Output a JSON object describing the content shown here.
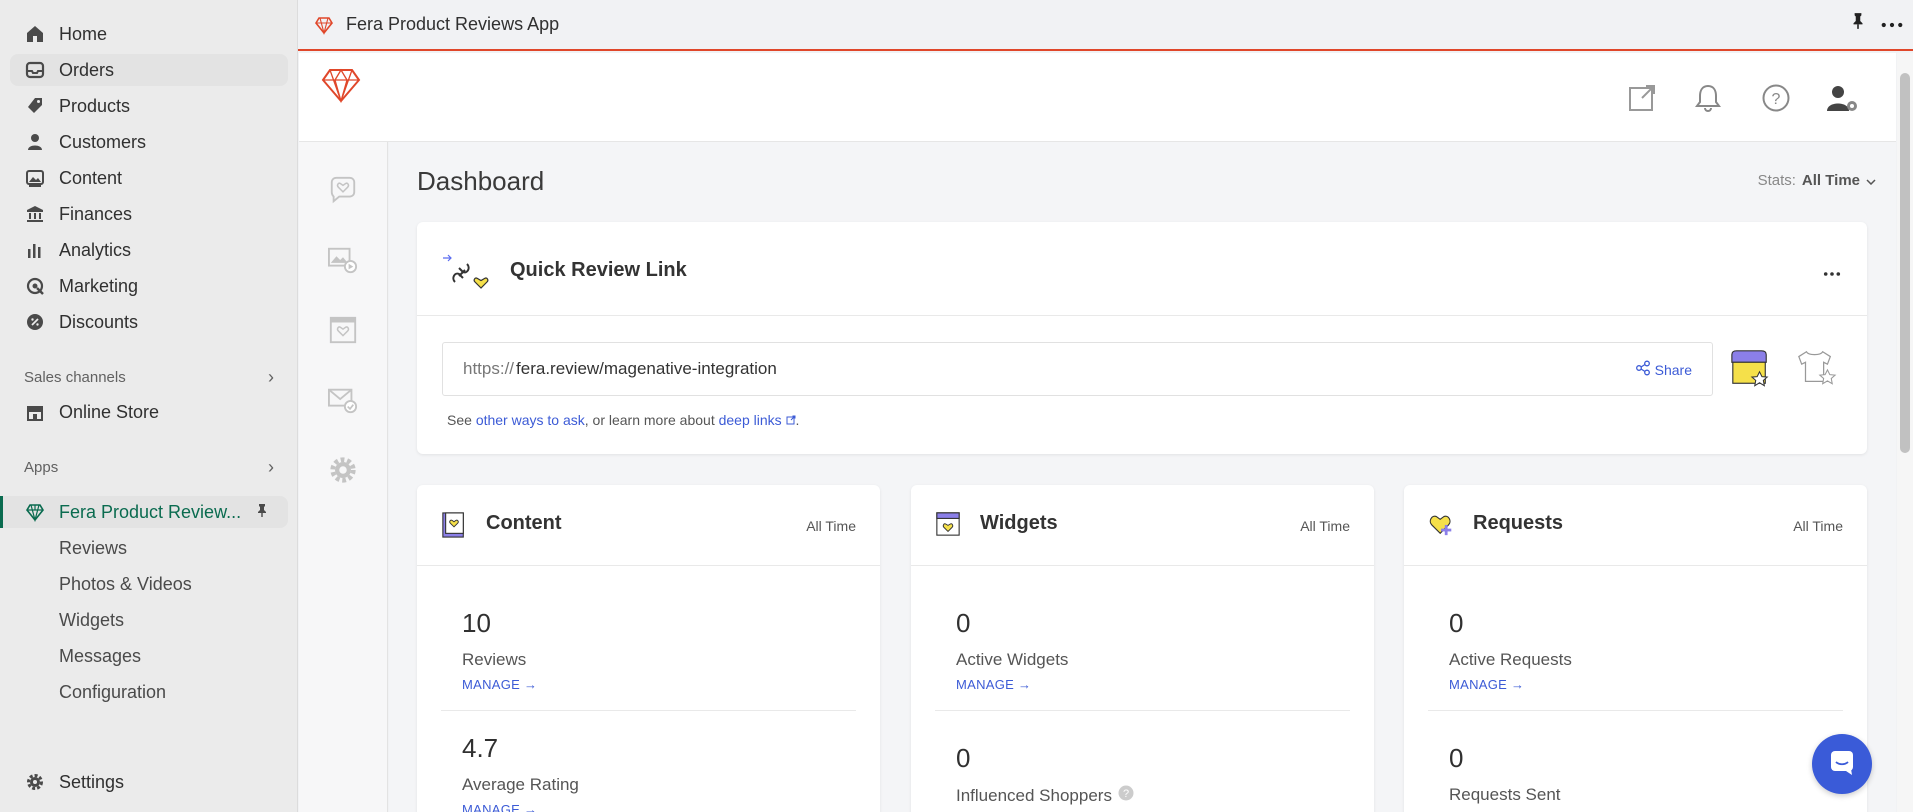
{
  "sidebar": {
    "items": [
      {
        "label": "Home",
        "icon": "home-icon"
      },
      {
        "label": "Orders",
        "icon": "orders-icon"
      },
      {
        "label": "Products",
        "icon": "tag-icon"
      },
      {
        "label": "Customers",
        "icon": "person-icon"
      },
      {
        "label": "Content",
        "icon": "image-icon"
      },
      {
        "label": "Finances",
        "icon": "bank-icon"
      },
      {
        "label": "Analytics",
        "icon": "bar-chart-icon"
      },
      {
        "label": "Marketing",
        "icon": "target-icon"
      },
      {
        "label": "Discounts",
        "icon": "discount-icon"
      }
    ],
    "sales_channels_label": "Sales channels",
    "online_store_label": "Online Store",
    "apps_label": "Apps",
    "app_name": "Fera Product Review...",
    "app_subitems": [
      "Reviews",
      "Photos & Videos",
      "Widgets",
      "Messages",
      "Configuration"
    ],
    "settings_label": "Settings"
  },
  "topbar": {
    "title": "Fera Product Reviews App"
  },
  "dashboard": {
    "title": "Dashboard",
    "stats_label": "Stats:",
    "stats_value": "All Time",
    "quick_link": {
      "title": "Quick Review Link",
      "url_prefix": "https://",
      "url_value": "fera.review/magenative-integration",
      "share_label": "Share",
      "help_see": "See",
      "help_link1": "other ways to ask",
      "help_mid": ", or learn more about",
      "help_link2": "deep links",
      "help_end": "."
    },
    "cards": [
      {
        "title": "Content",
        "period": "All Time",
        "stats": [
          {
            "value": "10",
            "label": "Reviews",
            "manage": "MANAGE →"
          },
          {
            "value": "4.7",
            "label": "Average Rating",
            "manage": "MANAGE →"
          }
        ]
      },
      {
        "title": "Widgets",
        "period": "All Time",
        "stats": [
          {
            "value": "0",
            "label": "Active Widgets",
            "manage": "MANAGE →"
          },
          {
            "value": "0",
            "label": "Influenced Shoppers"
          }
        ]
      },
      {
        "title": "Requests",
        "period": "All Time",
        "stats": [
          {
            "value": "0",
            "label": "Active Requests",
            "manage": "MANAGE →"
          },
          {
            "value": "0",
            "label": "Requests Sent"
          }
        ]
      }
    ]
  },
  "colors": {
    "accent_red": "#e0472a",
    "link_blue": "#3c5bd6",
    "app_green": "#0a6b4f",
    "chat_blue": "#3a5bd8",
    "icon_yellow": "#f5e04a",
    "icon_purple": "#8b7fe8"
  }
}
